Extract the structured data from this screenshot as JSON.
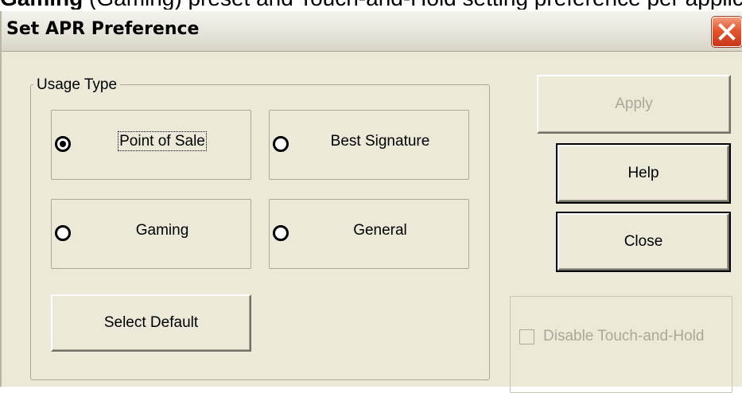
{
  "background": {
    "text_bold": "Gaming",
    "text_pre": "",
    "text_post": "(Gaming) preset and Touch-and-Hold setting preference per application."
  },
  "dialog": {
    "title": "Set APR Preference",
    "close_icon": "close-icon"
  },
  "usage_type": {
    "legend": "Usage Type",
    "options": [
      {
        "label": "Point of Sale",
        "selected": true
      },
      {
        "label": "Best Signature",
        "selected": false
      },
      {
        "label": "Gaming",
        "selected": false
      },
      {
        "label": "General",
        "selected": false
      }
    ],
    "select_default_label": "Select Default"
  },
  "buttons": {
    "apply_label": "Apply",
    "help_label": "Help",
    "close_label": "Close"
  },
  "touch_hold": {
    "label": "Disable Touch-and-Hold",
    "checked": false,
    "enabled": false
  },
  "colors": {
    "dialog_bg": "#ECE9D8",
    "disabled_text": "#ACA899",
    "close_button": "#E2572F"
  }
}
